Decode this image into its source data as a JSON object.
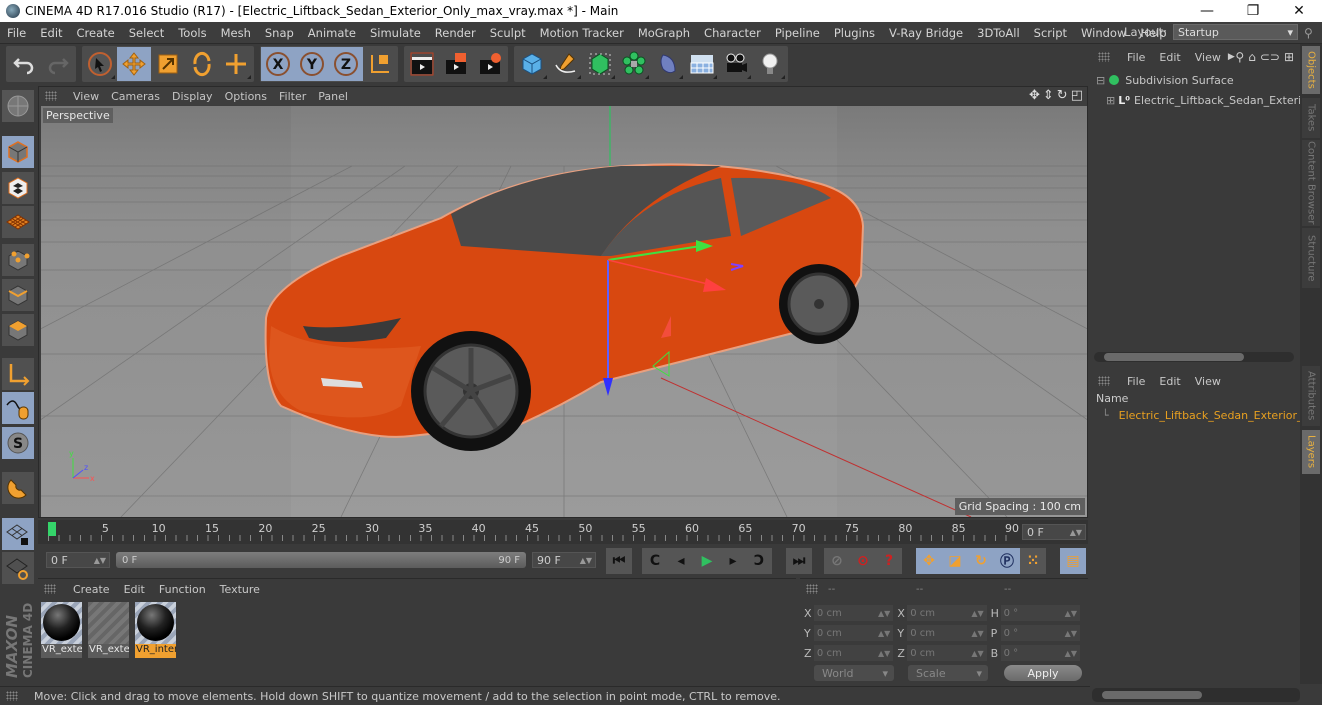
{
  "window": {
    "title": "CINEMA 4D R17.016 Studio (R17) - [Electric_Liftback_Sedan_Exterior_Only_max_vray.max *] - Main",
    "controls": {
      "minimize": "—",
      "restore": "❐",
      "close": "✕"
    }
  },
  "menu": [
    "File",
    "Edit",
    "Create",
    "Select",
    "Tools",
    "Mesh",
    "Snap",
    "Animate",
    "Simulate",
    "Render",
    "Sculpt",
    "Motion Tracker",
    "MoGraph",
    "Character",
    "Pipeline",
    "Plugins",
    "V-Ray Bridge",
    "3DToAll",
    "Script",
    "Window",
    "Help"
  ],
  "layout": {
    "label": "Layout:",
    "value": "Startup"
  },
  "toolbar": {
    "groups": [
      [
        "undo-icon",
        "redo-icon"
      ],
      [
        "live-selection-icon",
        "move-icon",
        "scale-icon",
        "rotate-icon",
        "recent-tool-icon"
      ],
      [
        "x-axis-icon",
        "y-axis-icon",
        "z-axis-icon",
        "coordinate-system-icon"
      ],
      [
        "render-view-icon",
        "render-picture-viewer-icon",
        "render-settings-icon"
      ],
      [
        "cube-icon",
        "pen-spline-icon",
        "subdivision-icon",
        "cloner-icon",
        "deformer-icon",
        "floor-icon",
        "camera-icon",
        "light-icon"
      ]
    ]
  },
  "viewport": {
    "menu": [
      "View",
      "Cameras",
      "Display",
      "Options",
      "Filter",
      "Panel"
    ],
    "camera_label": "Perspective",
    "grid_spacing": "Grid Spacing : 100 cm"
  },
  "timeline": {
    "ticks": [
      "0",
      "5",
      "10",
      "15",
      "20",
      "25",
      "30",
      "35",
      "40",
      "45",
      "50",
      "55",
      "60",
      "65",
      "70",
      "75",
      "80",
      "85",
      "90"
    ],
    "current_frame": "0 F",
    "start_field": "0 F",
    "range_start": "0 F",
    "range_end": "90 F",
    "end_field": "90 F"
  },
  "materials": {
    "menu": [
      "Create",
      "Edit",
      "Function",
      "Texture"
    ],
    "items": [
      {
        "label": "VR_exte",
        "selected": false,
        "has_preview": true
      },
      {
        "label": "VR_exte",
        "selected": false,
        "has_preview": false
      },
      {
        "label": "VR_inter",
        "selected": true,
        "has_preview": true
      }
    ]
  },
  "coordinates": {
    "headers": [
      "--",
      "--",
      "--"
    ],
    "rows": [
      {
        "a1": "X",
        "v1": "0 cm",
        "a2": "X",
        "v2": "0 cm",
        "a3": "H",
        "v3": "0 °"
      },
      {
        "a1": "Y",
        "v1": "0 cm",
        "a2": "Y",
        "v2": "0 cm",
        "a3": "P",
        "v3": "0 °"
      },
      {
        "a1": "Z",
        "v1": "0 cm",
        "a2": "Z",
        "v2": "0 cm",
        "a3": "B",
        "v3": "0 °"
      }
    ],
    "mode": "World",
    "transform": "Scale",
    "apply": "Apply"
  },
  "status": "Move: Click and drag to move elements. Hold down SHIFT to quantize movement / add to the selection in point mode, CTRL to remove.",
  "objects": {
    "menu": [
      "File",
      "Edit",
      "View"
    ],
    "tree": [
      {
        "name": "Subdivision Surface",
        "level": 0
      },
      {
        "name": "Electric_Liftback_Sedan_Exterior_",
        "level": 1
      }
    ]
  },
  "layers": {
    "menu": [
      "File",
      "Edit",
      "View"
    ],
    "header": "Name",
    "items": [
      {
        "name": "Electric_Liftback_Sedan_Exterior_C",
        "color": "#e07020"
      }
    ]
  },
  "side_tabs": [
    "Objects",
    "Takes",
    "Content Browser",
    "Structure",
    "Attributes",
    "Layers"
  ],
  "brand": {
    "line1": "MAXON",
    "line2": "CINEMA 4D"
  },
  "colors": {
    "accent": "#8ea3c4",
    "selection": "#f0a030",
    "car": "#d84810"
  }
}
